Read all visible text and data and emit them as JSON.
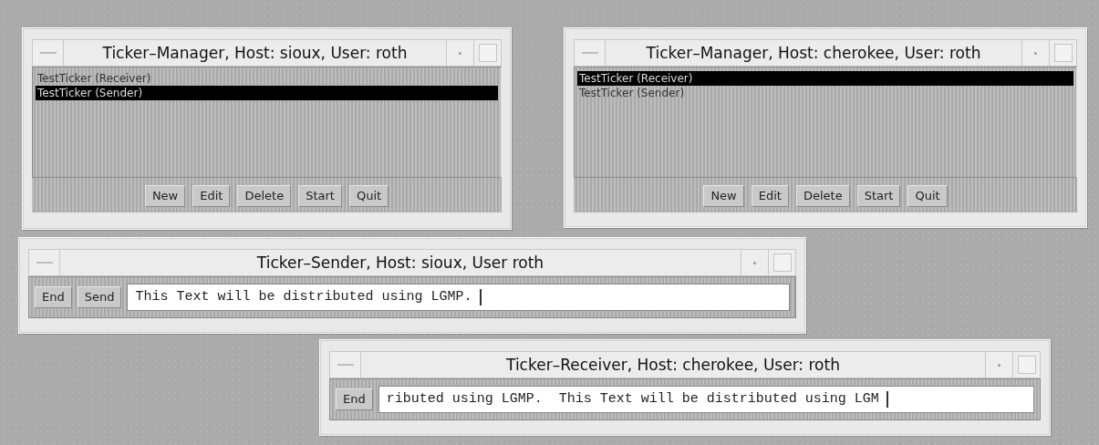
{
  "windows": [
    {
      "kind": "manager",
      "title": "Ticker–Manager, Host: sioux, User: roth",
      "items": [
        {
          "label": "TestTicker (Receiver)",
          "selected": false
        },
        {
          "label": "TestTicker (Sender)",
          "selected": true
        }
      ],
      "buttons": [
        "New",
        "Edit",
        "Delete",
        "Start",
        "Quit"
      ]
    },
    {
      "kind": "manager",
      "title": "Ticker–Manager, Host: cherokee, User: roth",
      "items": [
        {
          "label": "TestTicker (Receiver)",
          "selected": true
        },
        {
          "label": "TestTicker (Sender)",
          "selected": false
        }
      ],
      "buttons": [
        "New",
        "Edit",
        "Delete",
        "Start",
        "Quit"
      ]
    },
    {
      "kind": "ticker",
      "title": "Ticker–Sender, Host: sioux, User roth",
      "buttons": [
        "End",
        "Send"
      ],
      "value": "This Text will be distributed using LGMP."
    },
    {
      "kind": "ticker",
      "title": "Ticker–Receiver, Host: cherokee, User: roth",
      "buttons": [
        "End"
      ],
      "value": "ributed using LGMP.  This Text will be distributed using LGM"
    }
  ]
}
